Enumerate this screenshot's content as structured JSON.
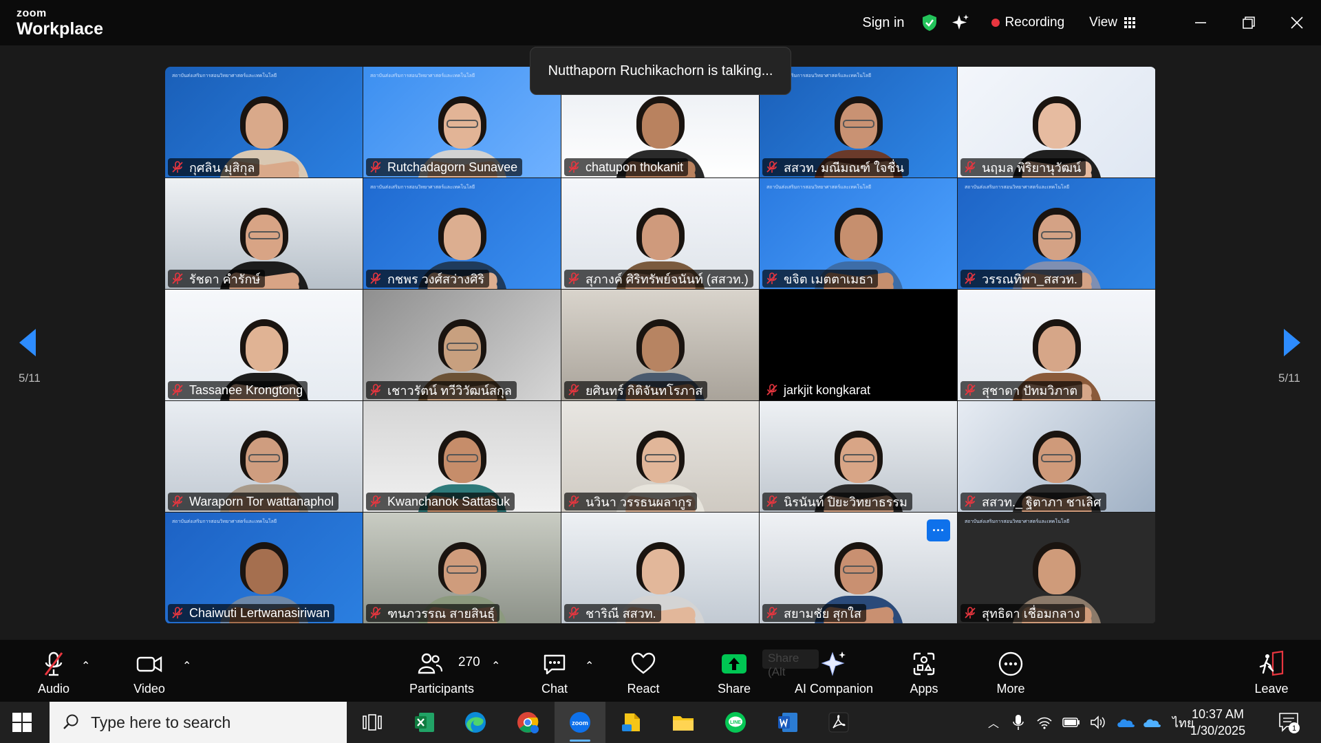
{
  "titlebar": {
    "logo_line1": "zoom",
    "logo_line2": "Workplace",
    "sign_in": "Sign in",
    "recording": "Recording",
    "view": "View"
  },
  "talking_toast": "Nutthaporn Ruchikachorn is talking...",
  "pagination": {
    "left": "5/11",
    "right": "5/11"
  },
  "participants": [
    {
      "name": "กุศลิน มุสิกุล"
    },
    {
      "name": "Rutchadagorn Sunavee"
    },
    {
      "name": "chatupon thokanit"
    },
    {
      "name": "สสวท. มณีมณฑ์ ใจชื่น"
    },
    {
      "name": "นฤมล พิริยานุวัฒน์"
    },
    {
      "name": "รัชดา คำรักษ์"
    },
    {
      "name": "กชพร วงศ์สว่างศิริ"
    },
    {
      "name": "สุภางค์ ศิริทรัพย์จนันท์ (สสวท.)"
    },
    {
      "name": "ขจิต เมตตาเมธา"
    },
    {
      "name": "วรรณทิพา_สสวท."
    },
    {
      "name": "Tassanee Krongtong"
    },
    {
      "name": "เชาวรัตน์ ทวีวิวัฒน์สกุล"
    },
    {
      "name": "ยศินทร์ กิติจันทโรภาส"
    },
    {
      "name": "jarkjit kongkarat"
    },
    {
      "name": "สุชาดา ปัทมวิภาต"
    },
    {
      "name": "Waraporn Tor wattanaphol"
    },
    {
      "name": "Kwanchanok Sattasuk"
    },
    {
      "name": "นวินา วรรธนผลากูร"
    },
    {
      "name": "นิรนันท์ ปิยะวิทยาธรรม"
    },
    {
      "name": "สสวท._ ฐิตาภา ชาเลิศ"
    },
    {
      "name": "Chaiwuti Lertwanasiriwan"
    },
    {
      "name": "ฑนภวรรณ สายสินธุ์"
    },
    {
      "name": "ชาริณี สสวท."
    },
    {
      "name": "สยามชัย สุกใส"
    },
    {
      "name": "สุทธิดา เชื่อมกลาง"
    }
  ],
  "toolbar": {
    "audio": "Audio",
    "video": "Video",
    "participants": "Participants",
    "participant_count": "270",
    "chat": "Chat",
    "react": "React",
    "share": "Share",
    "ai_companion": "AI Companion",
    "apps": "Apps",
    "more": "More",
    "leave": "Leave",
    "share_ghost": "Share (Alt"
  },
  "taskbar": {
    "search_placeholder": "Type here to search",
    "language": "ไทย",
    "time": "10:37 AM",
    "date": "1/30/2025",
    "notification_count": "1"
  },
  "colors": {
    "zoom_blue": "#0e71eb",
    "recording_red": "#e8363f",
    "mute_red": "#e8363f",
    "share_green": "#00c653"
  }
}
